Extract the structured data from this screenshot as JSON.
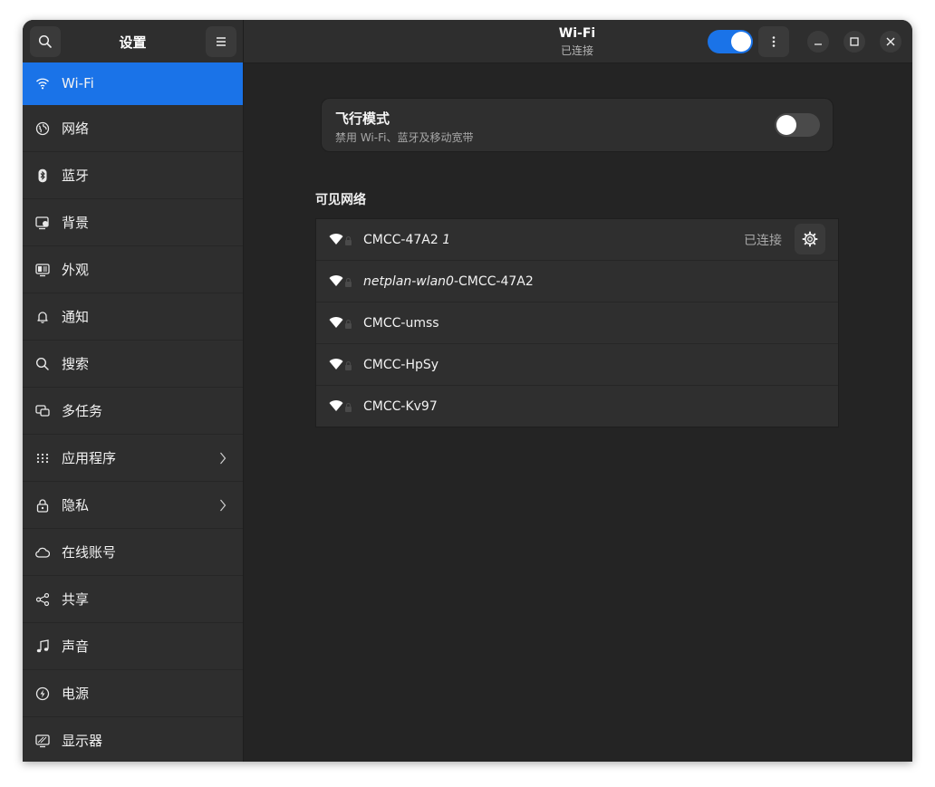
{
  "app": {
    "title": "设置",
    "header_title": "Wi-Fi",
    "header_subtitle": "已连接",
    "wifi_enabled": true
  },
  "sidebar": {
    "items": [
      {
        "label": "Wi-Fi",
        "icon": "wifi-icon",
        "active": true
      },
      {
        "label": "网络",
        "icon": "globe-icon"
      },
      {
        "label": "蓝牙",
        "icon": "bluetooth-icon"
      },
      {
        "label": "背景",
        "icon": "background-icon"
      },
      {
        "label": "外观",
        "icon": "appearance-icon"
      },
      {
        "label": "通知",
        "icon": "bell-icon"
      },
      {
        "label": "搜索",
        "icon": "search-icon"
      },
      {
        "label": "多任务",
        "icon": "multitasking-icon"
      },
      {
        "label": "应用程序",
        "icon": "apps-grid-icon",
        "has_submenu": true
      },
      {
        "label": "隐私",
        "icon": "lock-icon",
        "has_submenu": true
      },
      {
        "label": "在线账号",
        "icon": "cloud-icon"
      },
      {
        "label": "共享",
        "icon": "share-icon"
      },
      {
        "label": "声音",
        "icon": "music-note-icon"
      },
      {
        "label": "电源",
        "icon": "power-icon"
      },
      {
        "label": "显示器",
        "icon": "display-icon"
      }
    ]
  },
  "airplane_mode": {
    "title": "飞行模式",
    "subtitle": "禁用 Wi-Fi、蓝牙及移动宽带",
    "enabled": false
  },
  "visible_networks": {
    "title": "可见网络",
    "networks": [
      {
        "name": "CMCC-47A2",
        "suffix": "1",
        "status": "已连接"
      },
      {
        "name_italic": "netplan-wlan0",
        "name": "-CMCC-47A2"
      },
      {
        "name": "CMCC-umss"
      },
      {
        "name": "CMCC-HpSy"
      },
      {
        "name": "CMCC-Kv97"
      }
    ]
  },
  "colors": {
    "accent": "#1a73e8",
    "window_bg": "#242424",
    "sidebar_bg": "#2e2e2e"
  }
}
